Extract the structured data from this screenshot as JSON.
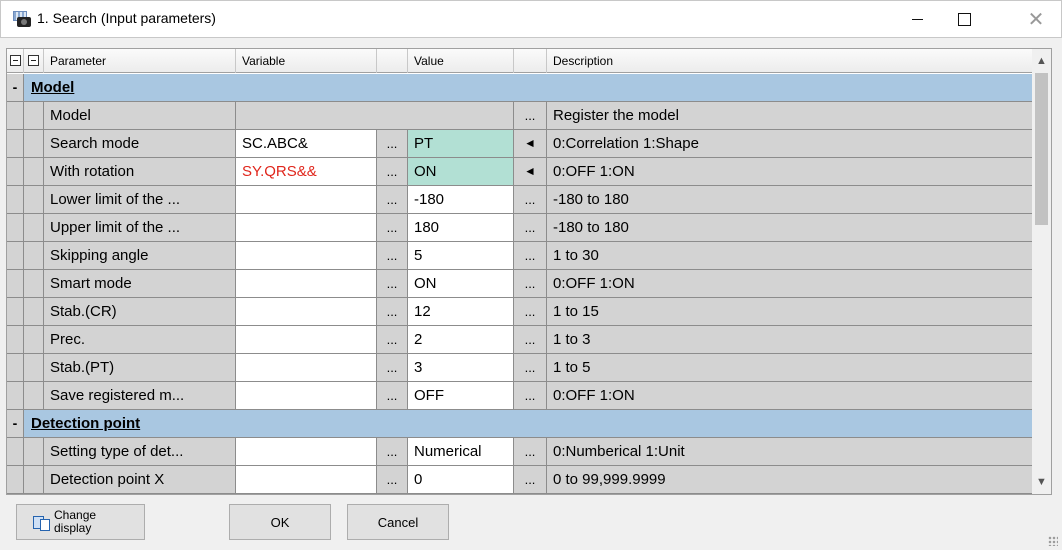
{
  "window": {
    "title": "1. Search (Input parameters)"
  },
  "header": {
    "parameter": "Parameter",
    "variable": "Variable",
    "value": "Value",
    "description": "Description"
  },
  "sections": [
    {
      "label": "Model",
      "rows": [
        {
          "parameter": "Model",
          "variable": "",
          "value": "",
          "description": "Register the model",
          "spans": true
        },
        {
          "parameter": "Search mode",
          "variable": "SC.ABC&",
          "value": "PT",
          "description": "0:Correlation 1:Shape",
          "value_teal": true,
          "has_arrow": true
        },
        {
          "parameter": "With rotation",
          "variable": "SY.QRS&&",
          "value": "ON",
          "description": "0:OFF 1:ON",
          "value_teal": true,
          "has_arrow": true,
          "variable_red": true
        },
        {
          "parameter": "Lower limit of the ...",
          "variable": "",
          "value": "-180",
          "description": "-180 to 180"
        },
        {
          "parameter": "Upper limit of the ...",
          "variable": "",
          "value": "180",
          "description": "-180 to 180"
        },
        {
          "parameter": "Skipping angle",
          "variable": "",
          "value": "5",
          "description": "1 to 30"
        },
        {
          "parameter": "Smart mode",
          "variable": "",
          "value": "ON",
          "description": "0:OFF 1:ON"
        },
        {
          "parameter": "Stab.(CR)",
          "variable": "",
          "value": "12",
          "description": "1 to 15"
        },
        {
          "parameter": "Prec.",
          "variable": "",
          "value": "2",
          "description": "1 to 3"
        },
        {
          "parameter": "Stab.(PT)",
          "variable": "",
          "value": "3",
          "description": "1 to 5"
        },
        {
          "parameter": "Save registered m...",
          "variable": "",
          "value": "OFF",
          "description": "0:OFF 1:ON"
        }
      ]
    },
    {
      "label": "Detection point",
      "rows": [
        {
          "parameter": "Setting type of det...",
          "variable": "",
          "value": "Numerical",
          "description": "0:Numberical 1:Unit"
        },
        {
          "parameter": "Detection point X",
          "variable": "",
          "value": "0",
          "description": "0 to 99,999.9999"
        }
      ]
    }
  ],
  "symbols": {
    "ellipsis": "...",
    "arrow": "◄",
    "collapse": "-",
    "close": "✕",
    "scroll_up": "▲",
    "scroll_down": "▼"
  },
  "buttons": {
    "change_display": "Change\ndisplay",
    "ok": "OK",
    "cancel": "Cancel"
  },
  "colors": {
    "section_bg": "#a9c7e1",
    "teal_value": "#b2e0d4",
    "red_variable": "#e0261c",
    "gray_cell": "#d3d3d3"
  }
}
